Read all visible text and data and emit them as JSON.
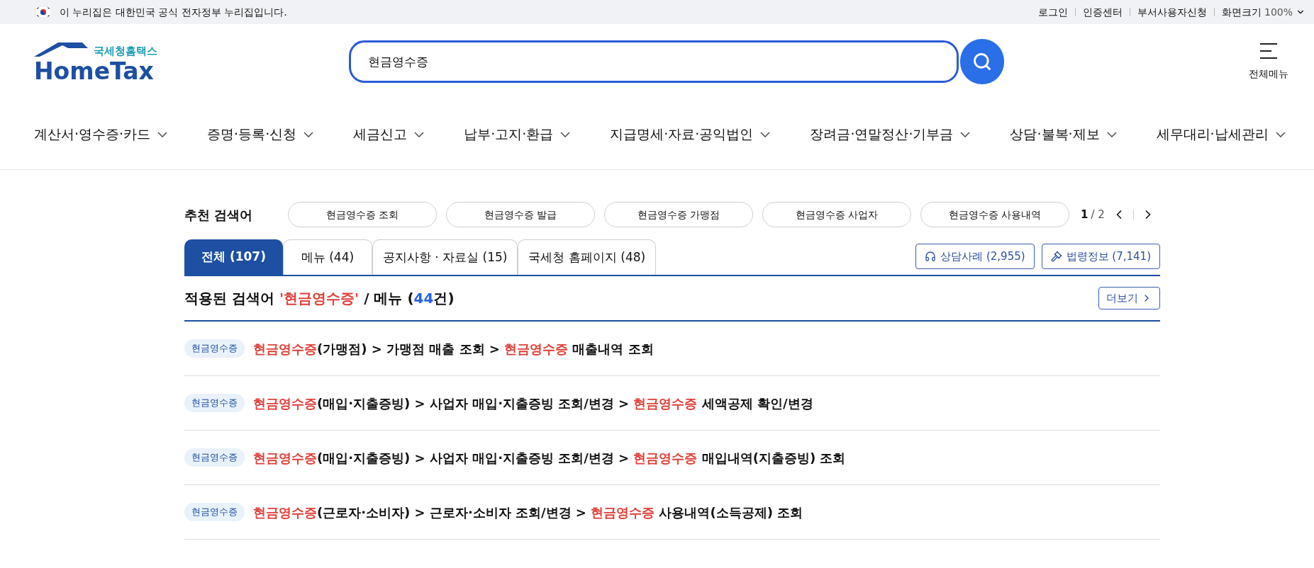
{
  "gov_banner": {
    "text": "이 누리집은 대한민국 공식 전자정부 누리집입니다.",
    "links": [
      "로그인",
      "인증센터",
      "부서사용자신청"
    ],
    "zoom_label": "화면크기",
    "zoom_value": "100%"
  },
  "header": {
    "logo_subtitle": "국세청홈택스",
    "logo_title": "HomeTax",
    "search": {
      "value": "현금영수증"
    },
    "all_menu_label": "전체메뉴"
  },
  "nav": [
    "계산서·영수증·카드",
    "증명·등록·신청",
    "세금신고",
    "납부·고지·환급",
    "지급명세·자료·공익법인",
    "장려금·연말정산·기부금",
    "상담·불복·제보",
    "세무대리·납세관리"
  ],
  "recommended": {
    "label": "추천 검색어",
    "keywords": [
      "현금영수증 조회",
      "현금영수증 발급",
      "현금영수증 가맹점",
      "현금영수증 사업자",
      "현금영수증 사용내역"
    ],
    "page": "1",
    "total": "/ 2"
  },
  "tabs": [
    {
      "label": "전체 (107)",
      "selected": true
    },
    {
      "label": "메뉴 (44)",
      "selected": false
    },
    {
      "label": "공지사항 · 자료실 (15)",
      "selected": false
    },
    {
      "label": "국세청 홈페이지 (48)",
      "selected": false
    }
  ],
  "side_buttons": [
    {
      "kind": "headset",
      "label": "상담사례 (2,955)"
    },
    {
      "kind": "gavel",
      "label": "법령정보 (7,141)"
    }
  ],
  "section": {
    "heading": [
      {
        "text": "적용된 검색어 ",
        "kind": "plain"
      },
      {
        "text": "'현금영수증'",
        "kind": "keyword"
      },
      {
        "text": " / 메뉴 (",
        "kind": "plain"
      },
      {
        "text": "44",
        "kind": "count"
      },
      {
        "text": "건)",
        "kind": "plain"
      }
    ],
    "more_label": "더보기"
  },
  "results": [
    {
      "tag": "현금영수증",
      "segments": [
        {
          "text": "현금영수증",
          "highlight": true
        },
        {
          "text": "(가맹점) > 가맹점 매출 조회 > ",
          "highlight": false
        },
        {
          "text": "현금영수증",
          "highlight": true
        },
        {
          "text": " 매출내역 조회",
          "highlight": false
        }
      ]
    },
    {
      "tag": "현금영수증",
      "segments": [
        {
          "text": "현금영수증",
          "highlight": true
        },
        {
          "text": "(매입·지출증빙) > 사업자 매입·지출증빙 조회/변경 > ",
          "highlight": false
        },
        {
          "text": "현금영수증",
          "highlight": true
        },
        {
          "text": " 세액공제 확인/변경",
          "highlight": false
        }
      ]
    },
    {
      "tag": "현금영수증",
      "segments": [
        {
          "text": "현금영수증",
          "highlight": true
        },
        {
          "text": "(매입·지출증빙) > 사업자 매입·지출증빙 조회/변경 > ",
          "highlight": false
        },
        {
          "text": "현금영수증",
          "highlight": true
        },
        {
          "text": " 매입내역(지출증빙) 조회",
          "highlight": false
        }
      ]
    },
    {
      "tag": "현금영수증",
      "segments": [
        {
          "text": "현금영수증",
          "highlight": true
        },
        {
          "text": "(근로자·소비자) > 근로자·소비자 조회/변경 > ",
          "highlight": false
        },
        {
          "text": "현금영수증",
          "highlight": true
        },
        {
          "text": " 사용내역(소득공제) 조회",
          "highlight": false
        }
      ]
    }
  ]
}
